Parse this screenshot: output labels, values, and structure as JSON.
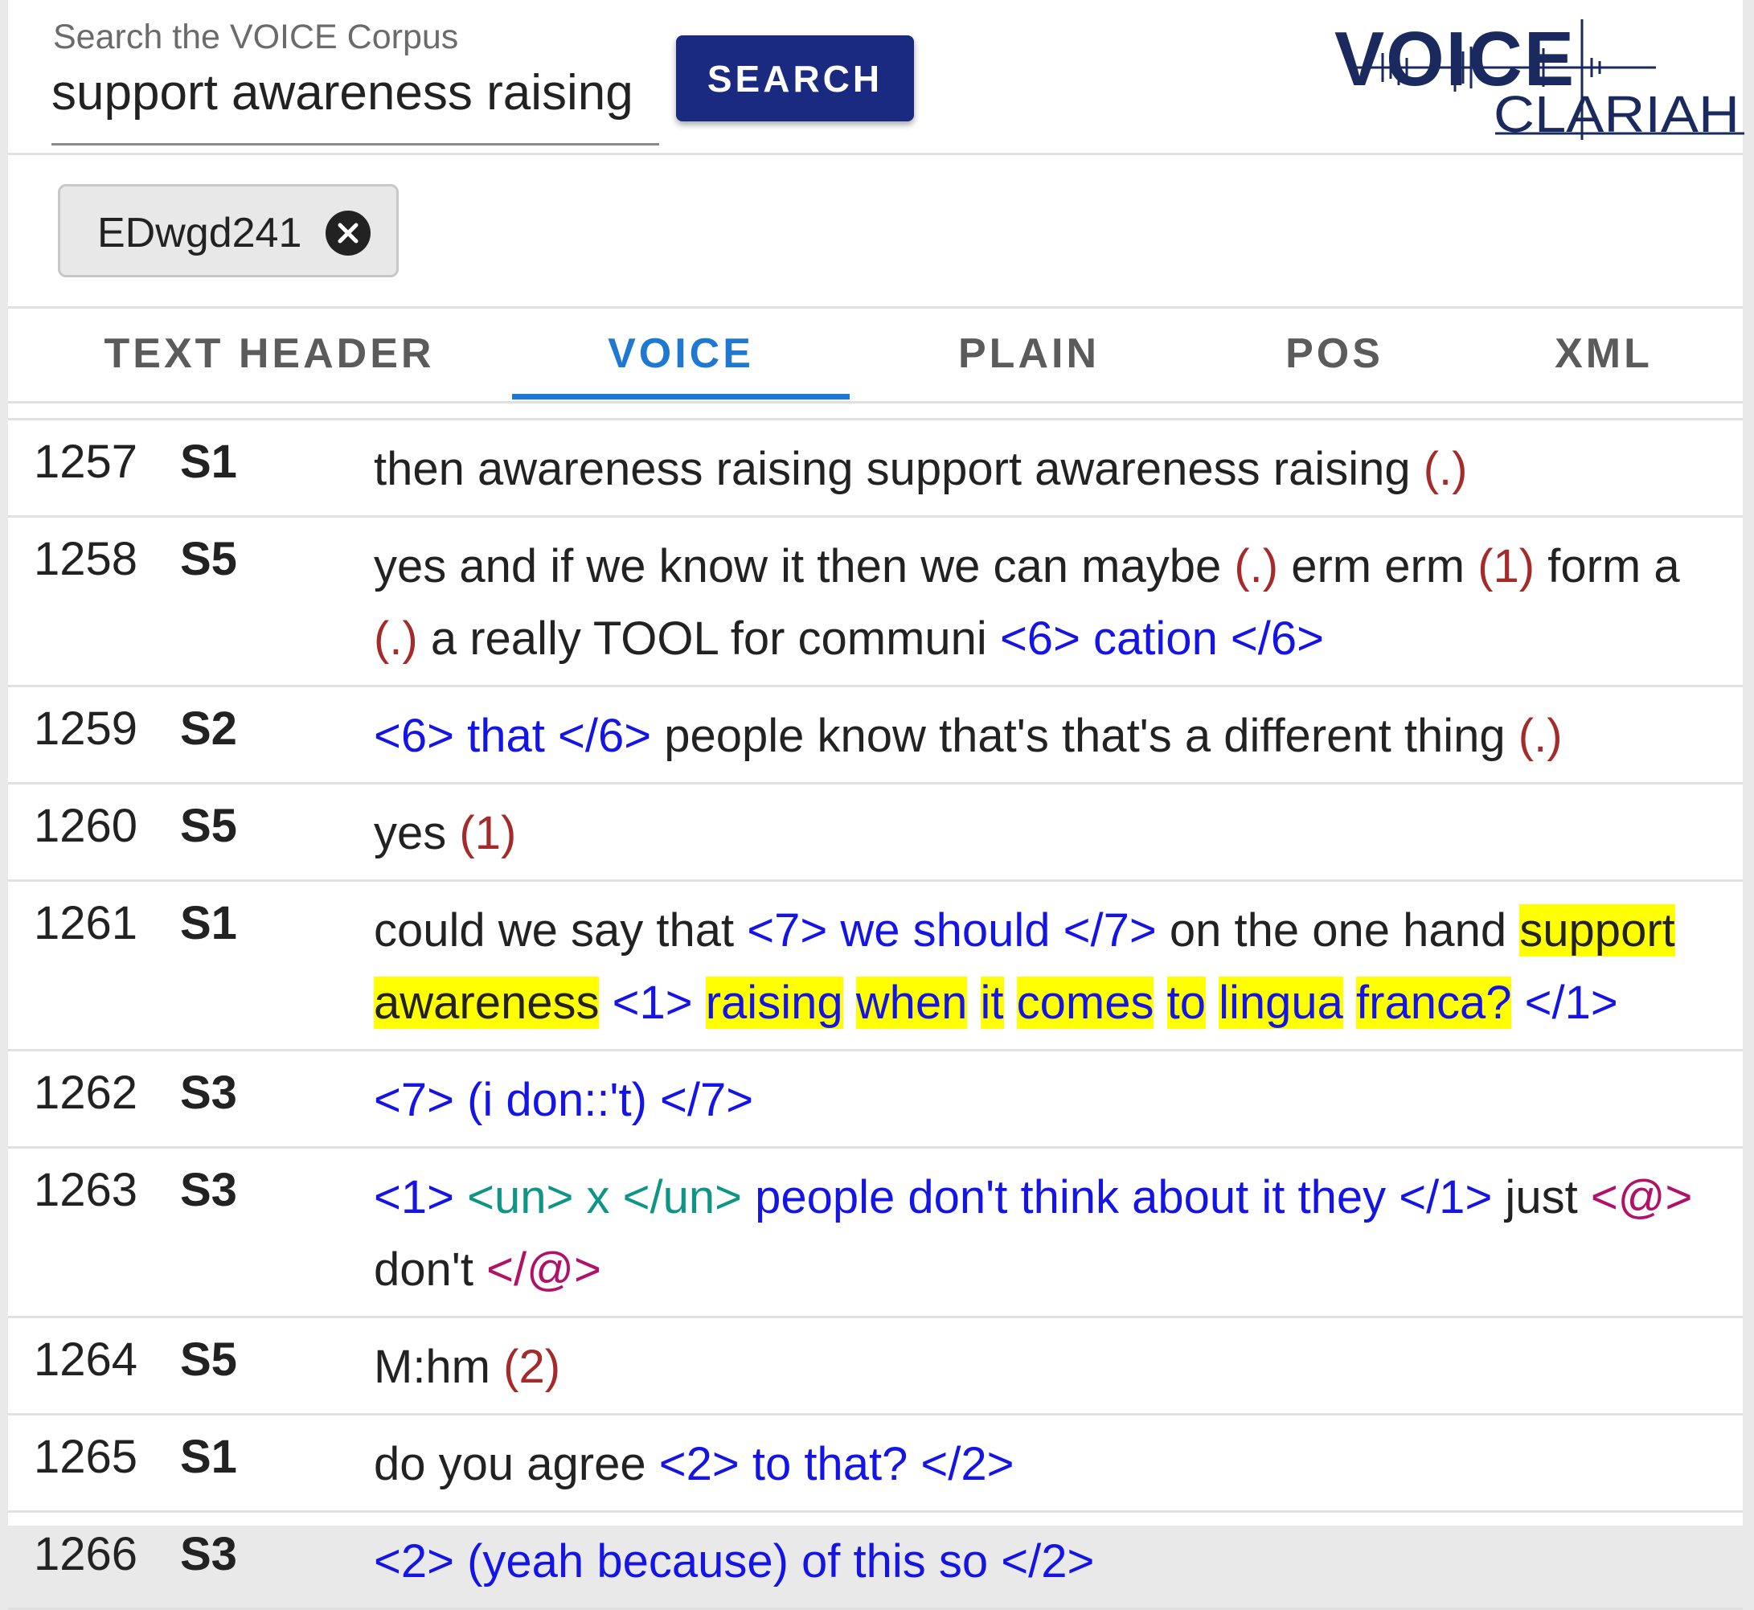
{
  "search": {
    "label": "Search the VOICE Corpus",
    "value": "support awareness raising",
    "button_label": "SEARCH"
  },
  "logo": {
    "voice": "VOICE",
    "clariah": "CLARIAH"
  },
  "filter_chip": {
    "label": "EDwgd241"
  },
  "tabs": [
    {
      "label": "TEXT HEADER",
      "active": false
    },
    {
      "label": "VOICE",
      "active": true
    },
    {
      "label": "PLAIN",
      "active": false
    },
    {
      "label": "POS",
      "active": false
    },
    {
      "label": "XML",
      "active": false
    }
  ],
  "colors": {
    "accent": "#1f78d1",
    "button": "#1a2a80",
    "pause": "#a52a2a",
    "overlap": "#1414e6",
    "unclear": "#0f9585",
    "laughter": "#b0126a",
    "highlight": "#ffff00"
  },
  "transcript": [
    {
      "line": "1257",
      "speaker": "S1",
      "segments": [
        {
          "t": "then awareness raising support awareness raising ",
          "c": ""
        },
        {
          "t": "(.)",
          "c": "red"
        }
      ]
    },
    {
      "line": "1258",
      "speaker": "S5",
      "segments": [
        {
          "t": "yes and if we know it then we can maybe ",
          "c": ""
        },
        {
          "t": "(.)",
          "c": "red"
        },
        {
          "t": " erm erm ",
          "c": ""
        },
        {
          "t": "(1)",
          "c": "red"
        },
        {
          "t": " form a ",
          "c": ""
        },
        {
          "t": "(.)",
          "c": "red"
        },
        {
          "t": " a really TOOL for communi ",
          "c": ""
        },
        {
          "t": "<6> cation </6>",
          "c": "blue"
        }
      ]
    },
    {
      "line": "1259",
      "speaker": "S2",
      "segments": [
        {
          "t": "<6> that </6>",
          "c": "blue"
        },
        {
          "t": " people know that's that's a different thing ",
          "c": ""
        },
        {
          "t": "(.)",
          "c": "red"
        }
      ]
    },
    {
      "line": "1260",
      "speaker": "S5",
      "segments": [
        {
          "t": "yes ",
          "c": ""
        },
        {
          "t": "(1)",
          "c": "red"
        }
      ]
    },
    {
      "line": "1261",
      "speaker": "S1",
      "segments": [
        {
          "t": "could we say that ",
          "c": ""
        },
        {
          "t": "<7> we should </7>",
          "c": "blue"
        },
        {
          "t": " on the one hand ",
          "c": ""
        },
        {
          "t": "support",
          "c": "hl"
        },
        {
          "t": " ",
          "c": ""
        },
        {
          "t": "awareness",
          "c": "hl"
        },
        {
          "t": " ",
          "c": ""
        },
        {
          "t": "<1>",
          "c": "blue"
        },
        {
          "t": " ",
          "c": ""
        },
        {
          "t": "raising",
          "c": "blue hl"
        },
        {
          "t": " ",
          "c": ""
        },
        {
          "t": "when",
          "c": "blue hl"
        },
        {
          "t": " ",
          "c": ""
        },
        {
          "t": "it",
          "c": "blue hl"
        },
        {
          "t": " ",
          "c": ""
        },
        {
          "t": "comes",
          "c": "blue hl"
        },
        {
          "t": " ",
          "c": ""
        },
        {
          "t": "to",
          "c": "blue hl"
        },
        {
          "t": " ",
          "c": ""
        },
        {
          "t": "lingua",
          "c": "blue hl"
        },
        {
          "t": " ",
          "c": ""
        },
        {
          "t": "franca?",
          "c": "blue hl"
        },
        {
          "t": " </1>",
          "c": "blue"
        }
      ]
    },
    {
      "line": "1262",
      "speaker": "S3",
      "segments": [
        {
          "t": "<7> (i don::'t) </7>",
          "c": "blue"
        }
      ]
    },
    {
      "line": "1263",
      "speaker": "S3",
      "segments": [
        {
          "t": "<1>",
          "c": "blue"
        },
        {
          "t": " ",
          "c": ""
        },
        {
          "t": "<un> x </un>",
          "c": "teal"
        },
        {
          "t": " people don't think about it they </1>",
          "c": "blue"
        },
        {
          "t": " just ",
          "c": ""
        },
        {
          "t": "<@>",
          "c": "mag"
        },
        {
          "t": " don't ",
          "c": ""
        },
        {
          "t": "</@>",
          "c": "mag"
        }
      ]
    },
    {
      "line": "1264",
      "speaker": "S5",
      "segments": [
        {
          "t": "M:hm ",
          "c": ""
        },
        {
          "t": "(2)",
          "c": "red"
        }
      ]
    },
    {
      "line": "1265",
      "speaker": "S1",
      "segments": [
        {
          "t": "do you agree ",
          "c": ""
        },
        {
          "t": "<2> to that? </2>",
          "c": "blue"
        }
      ]
    },
    {
      "line": "1266",
      "speaker": "S3",
      "segments": [
        {
          "t": "<2> (yeah because) of this so </2>",
          "c": "blue"
        }
      ]
    }
  ]
}
